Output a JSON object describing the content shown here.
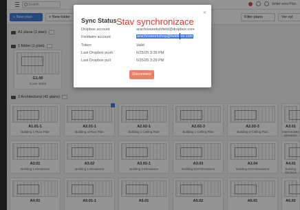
{
  "topbar": {
    "search_placeholder": "Search",
    "right_label": "Enter area Plus"
  },
  "toolbar": {
    "new_plan": "+ New plan",
    "new_folder": "+ New folder",
    "filter_plans": "Filter plans",
    "view": "Ver vyl"
  },
  "folders": {
    "first": "A1 plans (1 plan)",
    "second": "1 folder (1 plan)",
    "third": "2 Architectural (41 plans)"
  },
  "single_card": {
    "code": "G1.00",
    "name": "Cover sheet"
  },
  "cards": [
    {
      "code": "A1.01-1",
      "name": "Building 1 Floor Plan"
    },
    {
      "code": "A2.01-1",
      "name": "Building 4 Floor Plan"
    },
    {
      "code": "A2.02-1",
      "name": "Building 1 Ceiling Plan"
    },
    {
      "code": "A2.02-3",
      "name": "Building 1 Ceiling Plan"
    },
    {
      "code": "A2.02-3",
      "name": "Building 2 Ceiling Plan"
    },
    {
      "code": "A3.01",
      "name": "Intermediate Elevation"
    },
    {
      "code": "A3.01",
      "name": "Building 1 Elevations"
    },
    {
      "code": "A3.02",
      "name": "Building 1 Elevations"
    },
    {
      "code": "A3.02-1",
      "name": "Building 2 Elevations"
    },
    {
      "code": "A3.03",
      "name": "Building 5/10 Elevations"
    },
    {
      "code": "A3.04",
      "name": "Building 5/10 Elevations"
    },
    {
      "code": "A4.01",
      "name": "Building Sections"
    },
    {
      "code": "A4.01",
      "name": ""
    },
    {
      "code": "A5.01-1",
      "name": ""
    },
    {
      "code": "A5.01",
      "name": ""
    },
    {
      "code": "A5.02",
      "name": ""
    },
    {
      "code": "A6.01",
      "name": ""
    },
    {
      "code": "A6.02",
      "name": ""
    }
  ],
  "modal": {
    "title": "Sync Status",
    "annotation": "Stav synchronizace",
    "close": "×",
    "rows": [
      {
        "label": "Dropbox account",
        "value": "arachnoworkshfield@dropbox.com"
      },
      {
        "label": "Fieldwire account",
        "value": "arachnoworkshop@fieldwire.com"
      },
      {
        "label": "Token",
        "value": "Valid"
      },
      {
        "label": "Last Dropbox push",
        "value": "6/25/25 3:35 PM"
      },
      {
        "label": "Last Dropbox pull",
        "value": "6/25/25 3:29 PM"
      }
    ],
    "disconnect": "Disconnect"
  }
}
